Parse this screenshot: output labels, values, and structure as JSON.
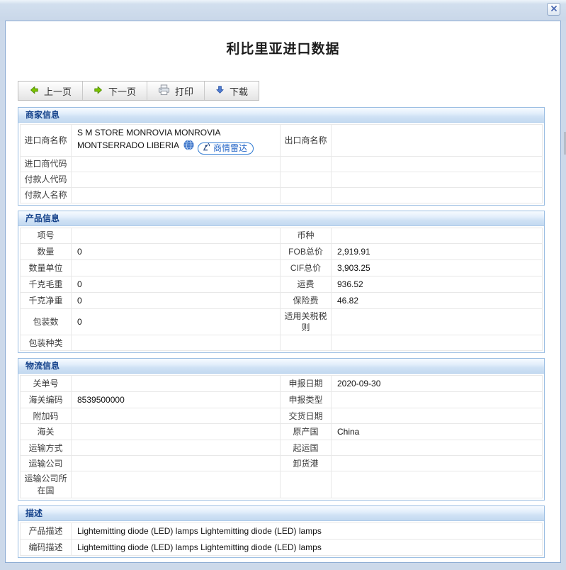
{
  "window": {
    "close_icon": "x-close",
    "background_color": "#ccd9ea",
    "dialog_border_color": "#8cabd3"
  },
  "page": {
    "title": "利比里亚进口数据"
  },
  "toolbar": {
    "prev_label": "上一页",
    "next_label": "下一页",
    "print_label": "打印",
    "download_label": "下载",
    "icons": [
      "green-arrow-left-icon",
      "green-arrow-right-icon",
      "printer-icon",
      "blue-arrow-down-icon"
    ]
  },
  "colors": {
    "section_header_text": "#15428b",
    "section_border": "#9abde2",
    "cell_border": "#e8e8e8",
    "radar_badge_blue": "#2f7ad2"
  },
  "sections": {
    "merchant": {
      "title": "商家信息",
      "radar_label": "商情雷达",
      "rows": [
        {
          "l_label": "进口商名称",
          "l_value": "S M STORE MONROVIA MONROVIA MONTSERRADO LIBERIA",
          "r_label": "出口商名称",
          "r_value": ""
        },
        {
          "l_label": "进口商代码",
          "l_value": "",
          "r_label": "",
          "r_value": ""
        },
        {
          "l_label": "付款人代码",
          "l_value": "",
          "r_label": "",
          "r_value": ""
        },
        {
          "l_label": "付款人名称",
          "l_value": "",
          "r_label": "",
          "r_value": ""
        }
      ]
    },
    "product": {
      "title": "产品信息",
      "rows": [
        {
          "l_label": "项号",
          "l_value": "",
          "r_label": "币种",
          "r_value": ""
        },
        {
          "l_label": "数量",
          "l_value": "0",
          "r_label": "FOB总价",
          "r_value": "2,919.91"
        },
        {
          "l_label": "数量单位",
          "l_value": "",
          "r_label": "CIF总价",
          "r_value": "3,903.25"
        },
        {
          "l_label": "千克毛重",
          "l_value": "0",
          "r_label": "运费",
          "r_value": "936.52"
        },
        {
          "l_label": "千克净重",
          "l_value": "0",
          "r_label": "保险费",
          "r_value": "46.82"
        },
        {
          "l_label": "包装数",
          "l_value": "0",
          "r_label": "适用关税税则",
          "r_value": ""
        },
        {
          "l_label": "包装种类",
          "l_value": "",
          "r_label": "",
          "r_value": ""
        }
      ]
    },
    "logistics": {
      "title": "物流信息",
      "rows": [
        {
          "l_label": "关单号",
          "l_value": "",
          "r_label": "申报日期",
          "r_value": "2020-09-30"
        },
        {
          "l_label": "海关编码",
          "l_value": "8539500000",
          "r_label": "申报类型",
          "r_value": ""
        },
        {
          "l_label": "附加码",
          "l_value": "",
          "r_label": "交货日期",
          "r_value": ""
        },
        {
          "l_label": "海关",
          "l_value": "",
          "r_label": "原产国",
          "r_value": "China"
        },
        {
          "l_label": "运输方式",
          "l_value": "",
          "r_label": "起运国",
          "r_value": ""
        },
        {
          "l_label": "运输公司",
          "l_value": "",
          "r_label": "卸货港",
          "r_value": ""
        },
        {
          "l_label": "运输公司所在国",
          "l_value": "",
          "r_label": "",
          "r_value": ""
        }
      ]
    },
    "description": {
      "title": "描述",
      "rows": [
        {
          "label": "产品描述",
          "value": "Lightemitting diode (LED) lamps Lightemitting diode (LED) lamps"
        },
        {
          "label": "编码描述",
          "value": "Lightemitting diode (LED) lamps Lightemitting diode (LED) lamps"
        }
      ]
    }
  }
}
